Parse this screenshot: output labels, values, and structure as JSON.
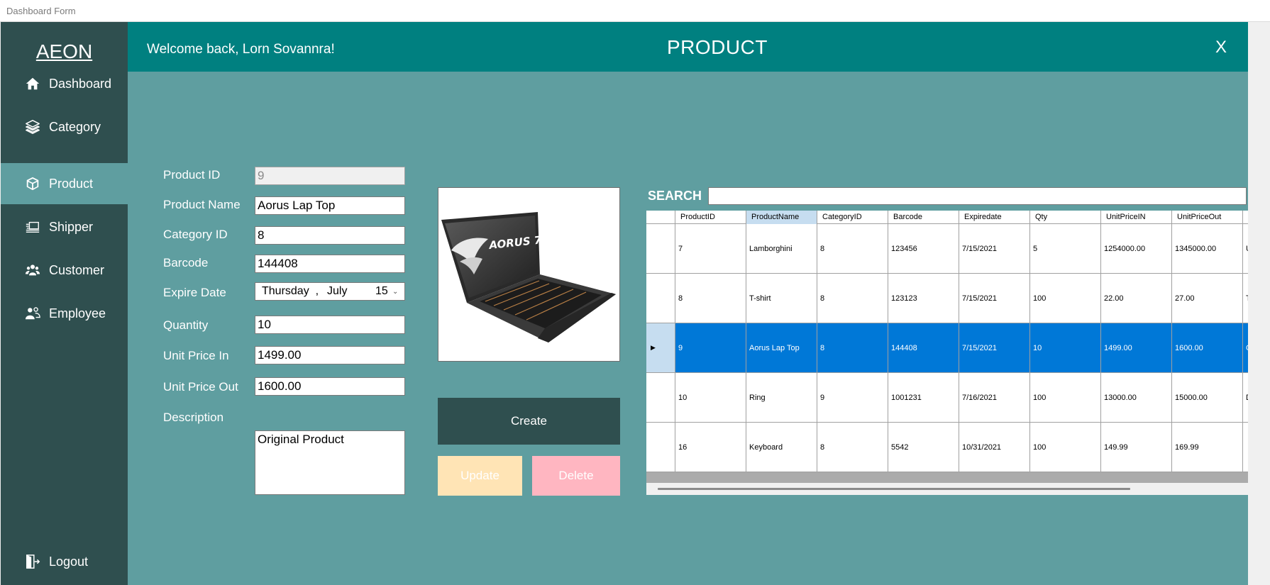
{
  "window": {
    "title": "Dashboard Form"
  },
  "sidebar": {
    "brand": "AEON",
    "items": [
      {
        "label": "Dashboard",
        "icon": "home-icon"
      },
      {
        "label": "Category",
        "icon": "layers-icon"
      },
      {
        "label": "Product",
        "icon": "box-icon"
      },
      {
        "label": "Shipper",
        "icon": "shipping-icon"
      },
      {
        "label": "Customer",
        "icon": "users-icon"
      },
      {
        "label": "Employee",
        "icon": "employee-icon"
      }
    ],
    "logout": "Logout"
  },
  "header": {
    "welcome": "Welcome back, Lorn Sovannra!",
    "title": "PRODUCT",
    "close": "X"
  },
  "form": {
    "product_id": {
      "label": "Product ID",
      "value": "9"
    },
    "product_name": {
      "label": "Product Name",
      "value": "Aorus Lap Top"
    },
    "category_id": {
      "label": "Category ID",
      "value": "8"
    },
    "barcode": {
      "label": "Barcode",
      "value": "144408"
    },
    "expire_date": {
      "label": "Expire Date",
      "day": "Thursday",
      "sep": ",",
      "month": "July",
      "date": "15"
    },
    "quantity": {
      "label": "Quantity",
      "value": "10"
    },
    "unit_price_in": {
      "label": "Unit Price In",
      "value": "1499.00"
    },
    "unit_price_out": {
      "label": "Unit Price Out",
      "value": "1600.00"
    },
    "description": {
      "label": "Description",
      "value": "Original Product"
    }
  },
  "image": {
    "logo_text": "AORUS 7"
  },
  "buttons": {
    "create": "Create",
    "update": "Update",
    "delete": "Delete"
  },
  "search": {
    "label": "SEARCH",
    "value": ""
  },
  "grid": {
    "columns": [
      "ProductID",
      "ProductName",
      "CategoryID",
      "Barcode",
      "Expiredate",
      "Qty",
      "UnitPriceIN",
      "UnitPriceOut"
    ],
    "selected_column": 1,
    "rows": [
      {
        "id": "7",
        "name": "Lamborghini",
        "cat": "8",
        "barcode": "123456",
        "exp": "7/15/2021",
        "qty": "5",
        "in": "1254000.00",
        "out": "1345000.00",
        "more": "U",
        "selected": false
      },
      {
        "id": "8",
        "name": "T-shirt",
        "cat": "8",
        "barcode": "123123",
        "exp": "7/15/2021",
        "qty": "100",
        "in": "22.00",
        "out": "27.00",
        "more": "T",
        "selected": false
      },
      {
        "id": "9",
        "name": "Aorus Lap Top",
        "cat": "8",
        "barcode": "144408",
        "exp": "7/15/2021",
        "qty": "10",
        "in": "1499.00",
        "out": "1600.00",
        "more": "O",
        "selected": true
      },
      {
        "id": "10",
        "name": "Ring",
        "cat": "9",
        "barcode": "1001231",
        "exp": "7/16/2021",
        "qty": "100",
        "in": "13000.00",
        "out": "15000.00",
        "more": "D",
        "selected": false
      },
      {
        "id": "16",
        "name": "Keyboard",
        "cat": "8",
        "barcode": "5542",
        "exp": "10/31/2021",
        "qty": "100",
        "in": "149.99",
        "out": "169.99",
        "more": "",
        "selected": false
      }
    ]
  },
  "colors": {
    "sidebar": "#2f4f4f",
    "header": "#008080",
    "content": "#5f9ea0",
    "selected_row": "#0078d7",
    "update_button": "#ffe4b5",
    "delete_button": "#ffb6c1"
  }
}
